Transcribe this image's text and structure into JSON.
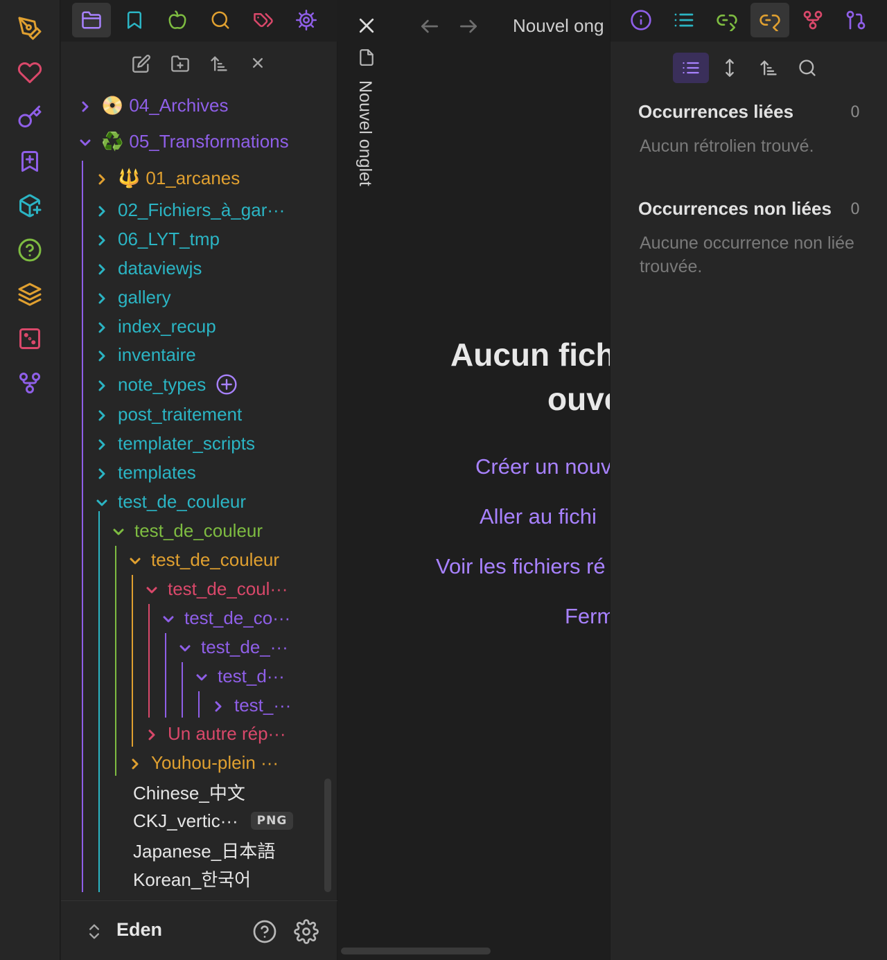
{
  "colors": {
    "accent": "#a882ff",
    "teal": "#2bb5c4",
    "green": "#7ebc41",
    "orange": "#e0a030",
    "red": "#d9486a",
    "purple": "#8f5fe8"
  },
  "ribbon": {
    "icons": [
      "pen-nib-icon",
      "heart-icon",
      "key-icon",
      "bookmark-plus-icon",
      "package-plus-icon",
      "help-circle-icon",
      "layers-icon",
      "dice-icon",
      "git-fork-icon"
    ]
  },
  "left_tabs": [
    "folder-icon",
    "bookmark-icon",
    "apple-icon",
    "search-icon",
    "tags-icon",
    "settings-icon"
  ],
  "left_actions": [
    "new-note-icon",
    "new-folder-icon",
    "sort-icon",
    "collapse-icon"
  ],
  "tree": {
    "items": [
      {
        "label": "04_Archives",
        "emoji": "📀"
      },
      {
        "label": "05_Transformations",
        "emoji": "♻️"
      },
      {
        "label": "01_arcanes",
        "emoji": "🔱"
      },
      {
        "label": "02_Fichiers_à_gar···"
      },
      {
        "label": "06_LYT_tmp"
      },
      {
        "label": "dataviewjs"
      },
      {
        "label": "gallery"
      },
      {
        "label": "index_recup"
      },
      {
        "label": "inventaire"
      },
      {
        "label": "note_types"
      },
      {
        "label": "post_traitement"
      },
      {
        "label": "templater_scripts"
      },
      {
        "label": "templates"
      },
      {
        "label": "test_de_couleur"
      },
      {
        "label": "test_de_couleur"
      },
      {
        "label": "test_de_couleur"
      },
      {
        "label": "test_de_coul···"
      },
      {
        "label": "test_de_co···"
      },
      {
        "label": "test_de_···"
      },
      {
        "label": "test_d···"
      },
      {
        "label": "test_···"
      },
      {
        "label": "Un autre rép···"
      },
      {
        "label": "Youhou-plein ···"
      },
      {
        "label": "Chinese_中文"
      },
      {
        "label": "CKJ_vertic···",
        "badge": "PNG"
      },
      {
        "label": "Japanese_日本語"
      },
      {
        "label": "Korean_한국어"
      }
    ]
  },
  "footer": {
    "vault": "Eden"
  },
  "center": {
    "tab_label": "Nouvel onglet",
    "nav_title": "Nouvel ong",
    "empty_title_line1": "Aucun fich",
    "empty_title_line2": "ouve",
    "actions": [
      "Créer un nouv",
      "Aller au fichi",
      "Voir les fichiers ré",
      "Ferm"
    ]
  },
  "right": {
    "tabs": [
      "info-icon",
      "list-icon",
      "link-out-icon",
      "link-in-icon",
      "graph-icon",
      "git-pull-icon"
    ],
    "linked_title": "Occurrences liées",
    "linked_count": "0",
    "linked_empty": "Aucun rétrolien trouvé.",
    "unlinked_title": "Occurrences non liées",
    "unlinked_count": "0",
    "unlinked_empty": "Aucune occurrence non liée trouvée."
  }
}
